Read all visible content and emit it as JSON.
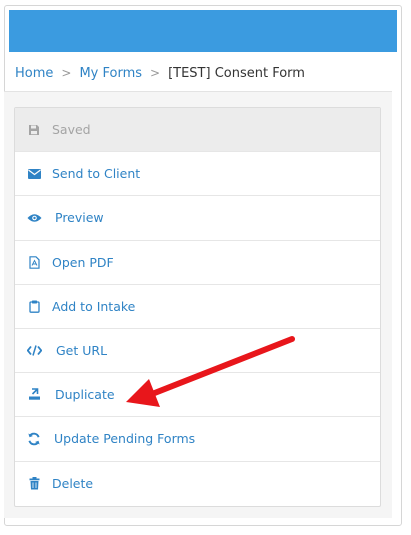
{
  "breadcrumb": {
    "home": "Home",
    "my_forms": "My Forms",
    "current": "[TEST] Consent Form",
    "separator": ">"
  },
  "menu": {
    "items": [
      {
        "label": "Saved",
        "icon": "save-icon",
        "disabled": true
      },
      {
        "label": "Send to Client",
        "icon": "envelope-icon",
        "disabled": false
      },
      {
        "label": "Preview",
        "icon": "eye-icon",
        "disabled": false
      },
      {
        "label": "Open PDF",
        "icon": "pdf-file-icon",
        "disabled": false
      },
      {
        "label": "Add to Intake",
        "icon": "clipboard-icon",
        "disabled": false
      },
      {
        "label": "Get URL",
        "icon": "code-icon",
        "disabled": false
      },
      {
        "label": "Duplicate",
        "icon": "duplicate-icon",
        "disabled": false
      },
      {
        "label": "Update Pending Forms",
        "icon": "refresh-icon",
        "disabled": false
      },
      {
        "label": "Delete",
        "icon": "trash-icon",
        "disabled": false
      }
    ]
  },
  "colors": {
    "header_bar": "#3b9be0",
    "link": "#2f83c5",
    "disabled_text": "#a4a4a4",
    "annotation_arrow": "#e8161b"
  }
}
